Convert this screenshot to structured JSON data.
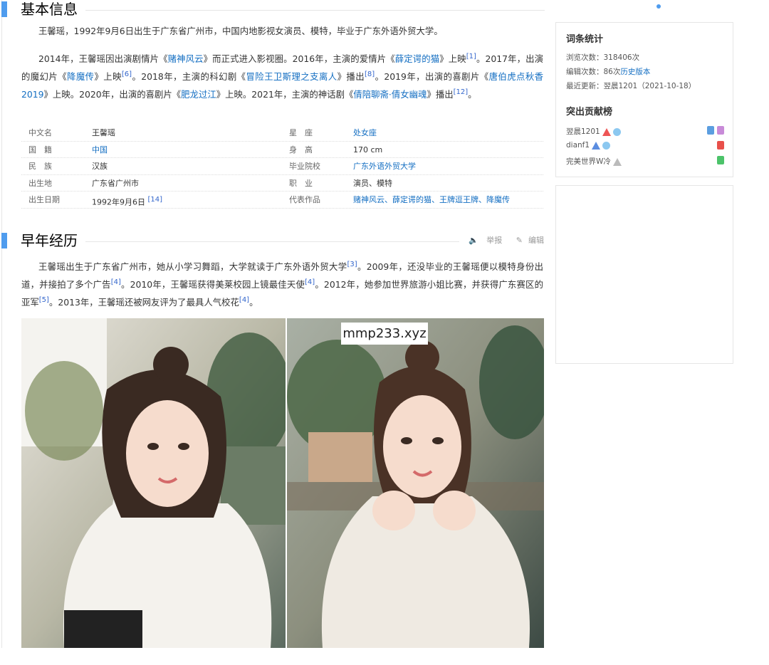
{
  "section1": {
    "title": "基本信息"
  },
  "intro": "王馨瑶，1992年9月6日出生于广东省广州市，中国内地影视女演员、模特，毕业于广东外语外贸大学。",
  "career": {
    "p1": "2014年，王馨瑶因出演剧情片《",
    "film1": "赌神风云",
    "p2": "》而正式进入影视圈。2016年，主演的爱情片《",
    "film2": "薛定谔的猫",
    "p3": "》上映",
    "ref1": "[1]",
    "p4": "。2017年，出演的魔幻片《",
    "film3": "降魔传",
    "p5": "》上映",
    "ref2": "[6]",
    "p6": "。2018年，主演的科幻剧《",
    "film4": "冒险王卫斯理之支离人",
    "p7": "》播出",
    "ref3": "[8]",
    "p8": "。2019年，出演的喜剧片《",
    "film5": "唐伯虎点秋香2019",
    "p9": "》上映。2020年，出演的喜剧片《",
    "film6": "肥龙过江",
    "p10": "》上映。2021年，主演的神话剧《",
    "film7": "倩陪聊斋·倩女幽魂",
    "p11": "》播出",
    "ref4": "[12]",
    "p12": "。"
  },
  "basic_table": {
    "rows": [
      {
        "l1": "中文名",
        "v1": "王馨瑶",
        "l2": "星　座",
        "v2": "处女座"
      },
      {
        "l1": "国　籍",
        "v1": "中国",
        "l2": "身　高",
        "v2": "170 cm"
      },
      {
        "l1": "民　族",
        "v1": "汉族",
        "l2": "毕业院校",
        "v2": "广东外语外贸大学"
      },
      {
        "l1": "出生地",
        "v1": "广东省广州市",
        "l2": "职　业",
        "v2": "演员、模特"
      },
      {
        "l1": "出生日期",
        "v1": "1992年9月6日",
        "v1ref": "[14]",
        "l2": "代表作品",
        "v2": "赌神风云、薛定谔的猫、王牌逗王牌、降魔传"
      }
    ]
  },
  "section2": {
    "title": "早年经历",
    "report": "举报",
    "edit": "编辑"
  },
  "early": {
    "p1": "王馨瑶出生于广东省广州市，她从小学习舞蹈，大学就读于广东外语外贸大学",
    "ref1": "[3]",
    "p2": "。2009年，还没毕业的王馨瑶便以模特身份出道，并接拍了多个广告",
    "ref2": "[4]",
    "p3": "。2010年，王馨瑶获得美莱校园上镜最佳天使",
    "ref3": "[4]",
    "p4": "。2012年，她参加世界旅游小姐比赛，并获得广东赛区的亚军",
    "ref4": "[5]",
    "p5": "。2013年，王馨瑶还被网友评为了最具人气校花",
    "ref5": "[4]",
    "p6": "。"
  },
  "watermark": "mmp233.xyz",
  "sidebar": {
    "stats_title": "词条统计",
    "views_label": "浏览次数：",
    "views": "318406次",
    "edits_label": "编辑次数：",
    "edits": "86次",
    "history_link": "历史版本",
    "updated_label": "最近更新：",
    "updated": "翌晨1201（2021-10-18）",
    "contrib_title": "突出贡献榜",
    "contributors": [
      "翌晨1201",
      "dianf1",
      "完美世界W冷"
    ]
  },
  "colors": {
    "accent": "#4f9cee",
    "link": "#136ec2"
  }
}
